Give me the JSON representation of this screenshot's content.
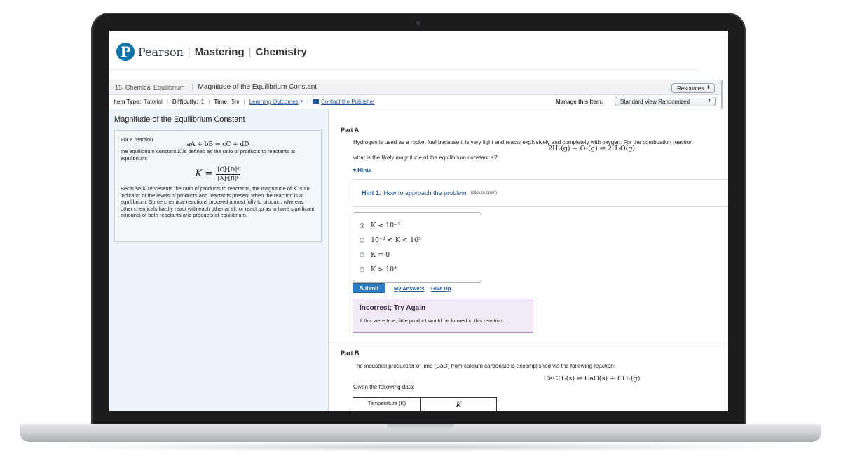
{
  "brand": {
    "logo_letter": "P",
    "name": "Pearson",
    "product_1": "Mastering",
    "product_2": "Chemistry"
  },
  "breadcrumb": {
    "chapter": "15. Chemical Equilibrium",
    "item": "Magnitude of the Equilibrium Constant"
  },
  "resources_select": "Resources",
  "item_info": {
    "type_label": "Item Type:",
    "type_value": "Tutorial",
    "difficulty_label": "Difficulty:",
    "difficulty_value": "1",
    "time_label": "Time:",
    "time_value": "5m",
    "learning_outcomes": "Learning Outcomes",
    "contact": "Contact the Publisher",
    "manage_label": "Manage this Item:",
    "view_select": "Standard View Randomized"
  },
  "intro": {
    "title": "Magnitude of the Equilibrium Constant",
    "reaction_lead": "For a reaction",
    "reaction_eq": "aA + bB ⇌ cC + dD",
    "defined_pre": "the equilibrium constant ",
    "k_symbol": "K",
    "defined_post": " is defined as the ratio of products to reactants at equilibrium:",
    "k_lhs": "K =",
    "k_num": "[C]ᶜ[D]ᵈ",
    "k_den": "[A]ᵃ[B]ᵇ",
    "because_pre": "Because ",
    "because_mid": " represents the ratio of products to reactants, the magnitude of ",
    "because_post": " is an indicator of the levels of products and reactants present when the reaction is at equilibrium. Some chemical reactions proceed almost fully to product, whereas other chemicals hardly react with each other at all, or react so as to have significant amounts of both reactants and products at equilibrium."
  },
  "part_a": {
    "label": "Part A",
    "question_1": "Hydrogen is used as a rocket fuel because it is very light and reacts explosively and completely with oxygen. For the combustion reaction",
    "equation": "2H₂(g) + O₂(g) ⇌ 2H₂O(g)",
    "question_2": "what is the likely magnitude of the equilibrium constant K?",
    "hints_toggle": "Hints",
    "hint_number": "Hint 1.",
    "hint_title": "How to approach the problem",
    "hint_open": "(click to open)",
    "choices": [
      {
        "label": "K < 10⁻³",
        "selected": true
      },
      {
        "label": "10⁻³ < K < 10³",
        "selected": false
      },
      {
        "label": "K = 0",
        "selected": false
      },
      {
        "label": "K > 10³",
        "selected": false
      }
    ],
    "submit": "Submit",
    "my_answers": "My Answers",
    "give_up": "Give Up",
    "feedback_title": "Incorrect; Try Again",
    "feedback_text": "If this were true, little product would be formed in this reaction."
  },
  "part_b": {
    "label": "Part B",
    "question": "The industrial production of lime (CaO) from calcium carbonate is accomplished via the following reaction:",
    "equation": "CaCO₃(s) ⇌ CaO(s) + CO₂(g)",
    "given": "Given the following data:",
    "table_header_1": "Temperature (K)",
    "table_header_2": "K"
  },
  "colors": {
    "brand_blue": "#0d73a8",
    "link_blue": "#21579b",
    "submit_blue": "#2d7cc8",
    "feedback_bg": "#f2e9f7",
    "feedback_border": "#b88fcf",
    "left_panel_bg": "#ecf3f9"
  }
}
